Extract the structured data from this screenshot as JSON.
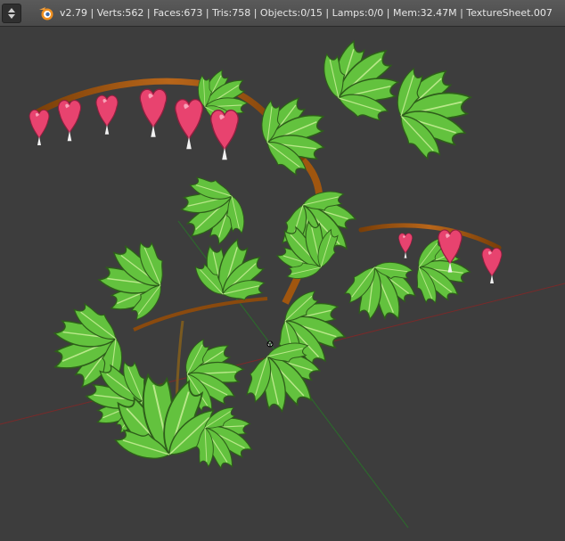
{
  "window": {
    "stats": "v2.79 | Verts:562 | Faces:673 | Tris:758 | Objects:0/15 | Lamps:0/0 | Mem:32.47M | TextureSheet.007"
  },
  "icons": {
    "menu": "updown-arrows-icon",
    "logo": "blender-logo-icon"
  },
  "colors": {
    "viewport_bg": "#3d3d3d",
    "header_bg": "#4a4a4a",
    "axis_x": "#8a2a2a",
    "axis_y": "#2a7a2a",
    "leaf": "#5fbf3c",
    "stem": "#a0560f",
    "flower": "#e8436f"
  }
}
